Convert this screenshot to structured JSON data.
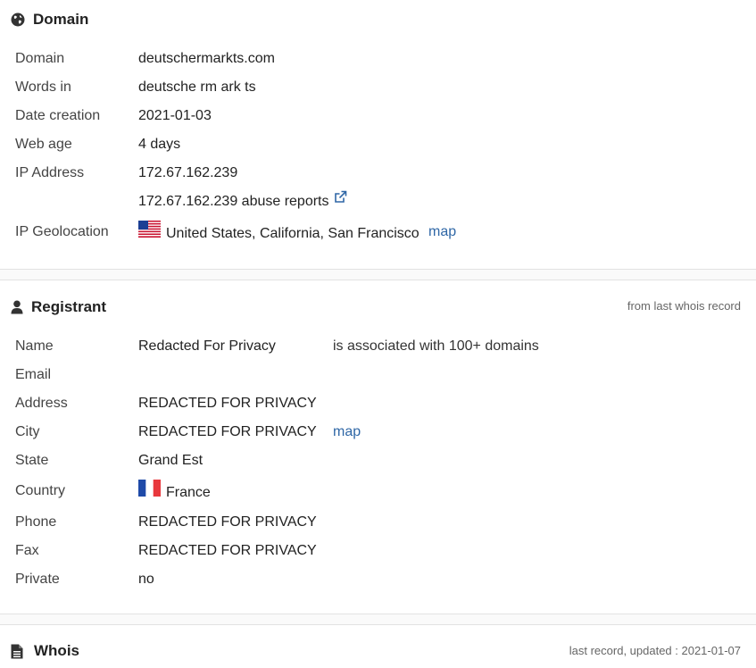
{
  "domain_section": {
    "title": "Domain",
    "rows": [
      {
        "label": "Domain",
        "value": "deutschermarkts.com"
      },
      {
        "label": "Words in",
        "value": "deutsche rm ark ts"
      },
      {
        "label": "Date creation",
        "value": "2021-01-03"
      },
      {
        "label": "Web age",
        "value": "4 days"
      },
      {
        "label": "IP Address",
        "value": "172.67.162.239"
      },
      {
        "label": "",
        "value": "172.67.162.239 abuse reports"
      },
      {
        "label": "IP Geolocation",
        "value": "United States, California, San Francisco",
        "map_link": "map"
      }
    ]
  },
  "registrant_section": {
    "title": "Registrant",
    "note": "from last whois record",
    "name_assoc": "is associated with 100+ domains",
    "city_map": "map",
    "rows": [
      {
        "label": "Name",
        "value": "Redacted For Privacy"
      },
      {
        "label": "Email",
        "value": ""
      },
      {
        "label": "Address",
        "value": "REDACTED FOR PRIVACY"
      },
      {
        "label": "City",
        "value": "REDACTED FOR PRIVACY"
      },
      {
        "label": "State",
        "value": "Grand Est"
      },
      {
        "label": "Country",
        "value": "France"
      },
      {
        "label": "Phone",
        "value": "REDACTED FOR PRIVACY"
      },
      {
        "label": "Fax",
        "value": "REDACTED FOR PRIVACY"
      },
      {
        "label": "Private",
        "value": "no"
      }
    ]
  },
  "whois_section": {
    "title": "Whois",
    "note": "last record, updated : 2021-01-07"
  },
  "colors": {
    "link": "#2f67a6",
    "text": "#222222",
    "label": "#444444",
    "muted": "#666666"
  },
  "icons": [
    "globe-icon",
    "user-icon",
    "document-icon",
    "external-link-icon",
    "us-flag-icon",
    "fr-flag-icon"
  ]
}
